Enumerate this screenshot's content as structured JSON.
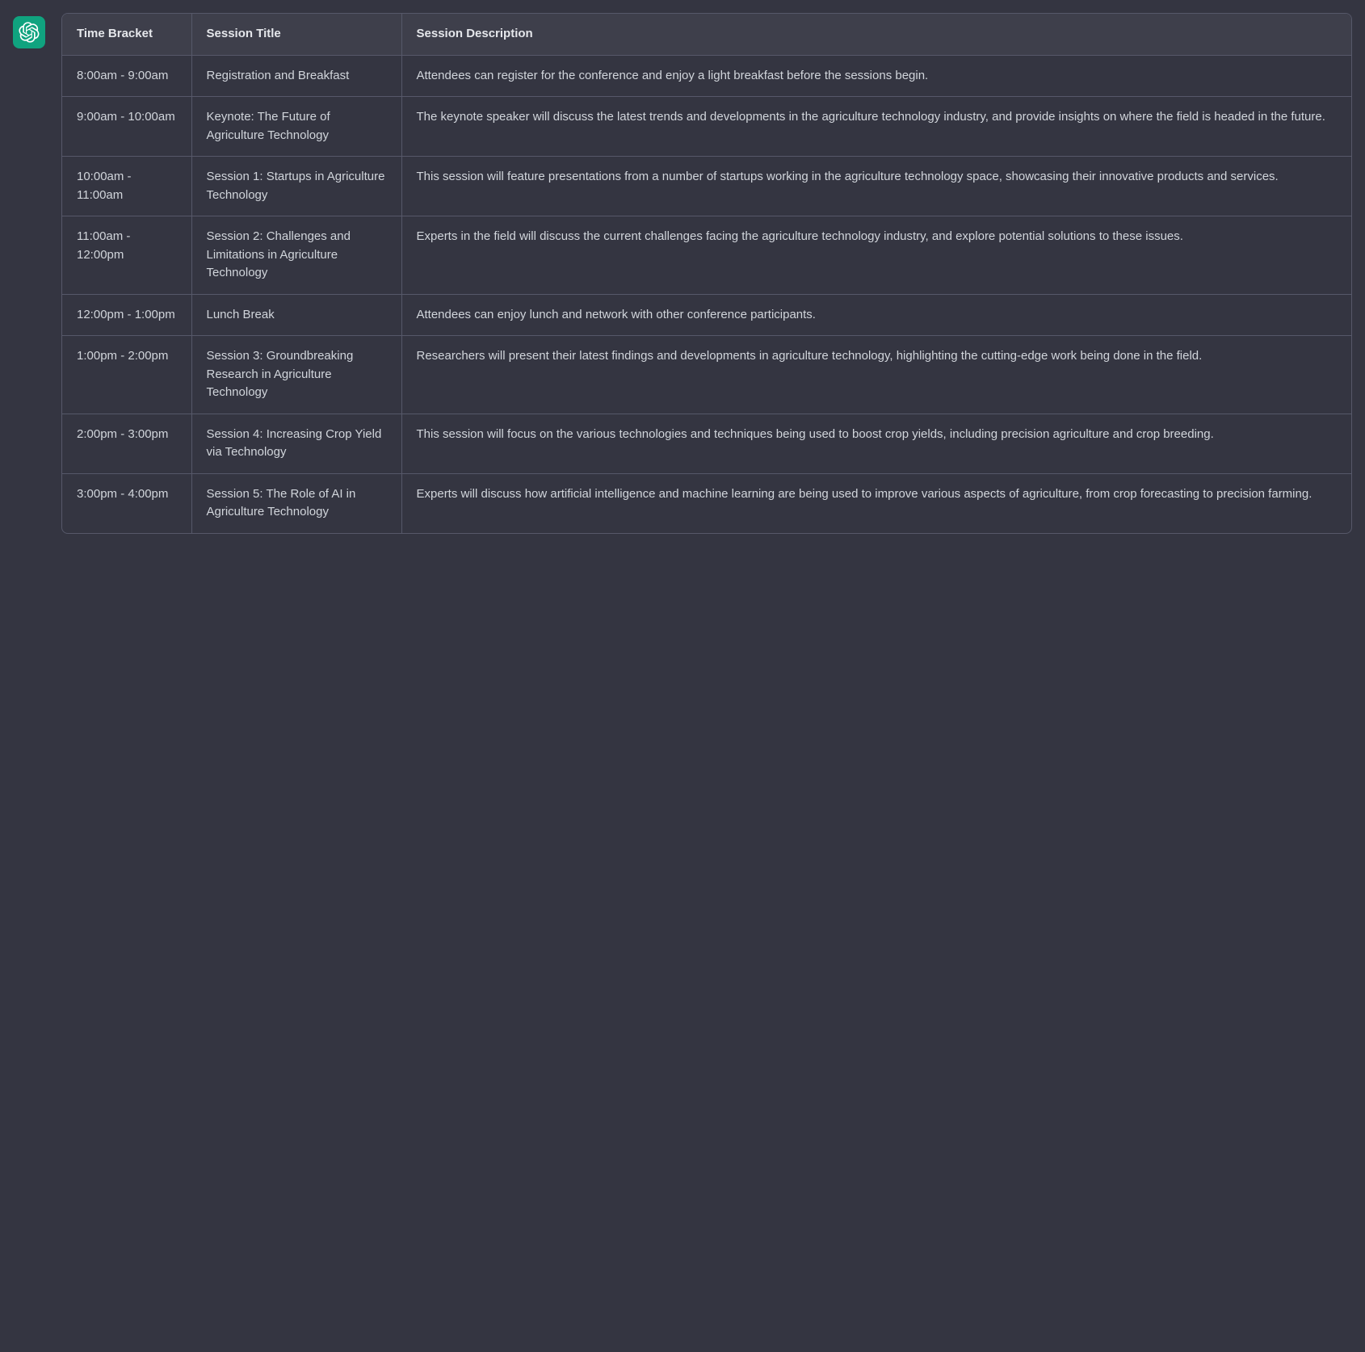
{
  "logo": {
    "alt": "ChatGPT logo"
  },
  "table": {
    "headers": {
      "time": "Time Bracket",
      "title": "Session Title",
      "description": "Session Description"
    },
    "rows": [
      {
        "time": "8:00am - 9:00am",
        "title": "Registration and Breakfast",
        "description": "Attendees can register for the conference and enjoy a light breakfast before the sessions begin."
      },
      {
        "time": "9:00am - 10:00am",
        "title": "Keynote: The Future of Agriculture Technology",
        "description": "The keynote speaker will discuss the latest trends and developments in the agriculture technology industry, and provide insights on where the field is headed in the future."
      },
      {
        "time": "10:00am - 11:00am",
        "title": "Session 1: Startups in Agriculture Technology",
        "description": "This session will feature presentations from a number of startups working in the agriculture technology space, showcasing their innovative products and services."
      },
      {
        "time": "11:00am - 12:00pm",
        "title": "Session 2: Challenges and Limitations in Agriculture Technology",
        "description": "Experts in the field will discuss the current challenges facing the agriculture technology industry, and explore potential solutions to these issues."
      },
      {
        "time": "12:00pm - 1:00pm",
        "title": "Lunch Break",
        "description": "Attendees can enjoy lunch and network with other conference participants."
      },
      {
        "time": "1:00pm - 2:00pm",
        "title": "Session 3: Groundbreaking Research in Agriculture Technology",
        "description": "Researchers will present their latest findings and developments in agriculture technology, highlighting the cutting-edge work being done in the field."
      },
      {
        "time": "2:00pm - 3:00pm",
        "title": "Session 4: Increasing Crop Yield via Technology",
        "description": "This session will focus on the various technologies and techniques being used to boost crop yields, including precision agriculture and crop breeding."
      },
      {
        "time": "3:00pm - 4:00pm",
        "title": "Session 5: The Role of AI in Agriculture Technology",
        "description": "Experts will discuss how artificial intelligence and machine learning are being used to improve various aspects of agriculture, from crop forecasting to precision farming."
      }
    ]
  }
}
